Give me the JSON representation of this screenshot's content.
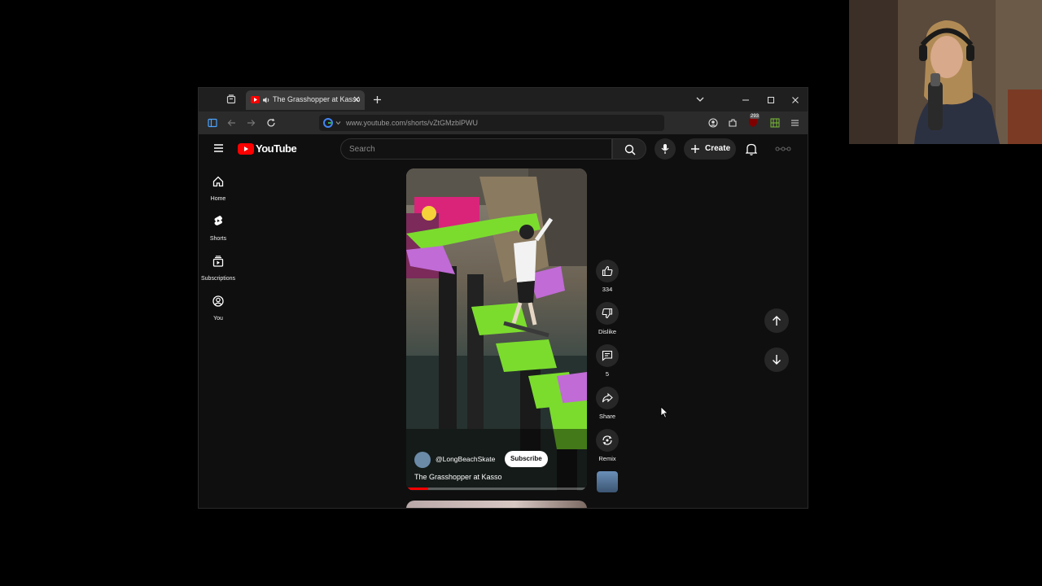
{
  "browser": {
    "tab_title": "The Grasshopper at Kasso",
    "url": "www.youtube.com/shorts/vZtGMzblPWU",
    "extension_badge": "293"
  },
  "youtube": {
    "logo_text": "YouTube",
    "search_placeholder": "Search",
    "create_label": "Create",
    "nav": [
      {
        "label": "Home",
        "icon": "home-icon"
      },
      {
        "label": "Shorts",
        "icon": "shorts-icon"
      },
      {
        "label": "Subscriptions",
        "icon": "subscriptions-icon"
      },
      {
        "label": "You",
        "icon": "you-icon"
      }
    ],
    "short": {
      "channel": "@LongBeachSkate",
      "subscribe_label": "Subscribe",
      "title": "The Grasshopper at Kasso",
      "progress_fraction": 0.12
    },
    "actions": {
      "likes": "334",
      "dislike_label": "Dislike",
      "comments": "5",
      "share_label": "Share",
      "remix_label": "Remix"
    }
  },
  "colors": {
    "yt_red": "#ff0000",
    "background": "#0f0f0f",
    "chip": "#272727",
    "accent_green": "#7bdc2e",
    "accent_purple": "#c06bd6"
  }
}
